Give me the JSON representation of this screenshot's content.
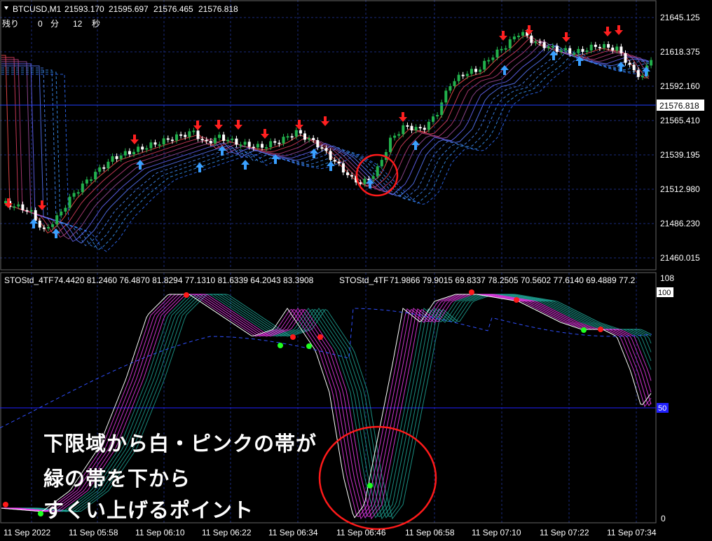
{
  "main_chart": {
    "symbol_header": "BTCUSD,M1",
    "ohlc": [
      "21593.170",
      "21595.697",
      "21576.465",
      "21576.818"
    ],
    "remaining_label": "残り",
    "remaining_min": "0",
    "min_unit": "分",
    "remaining_sec": "12",
    "sec_unit": "秒",
    "price_axis": [
      "21645.125",
      "21618.375",
      "21592.160",
      "21565.410",
      "21539.195",
      "21512.980",
      "21486.230",
      "21460.015"
    ],
    "current_price_tag": "21576.818"
  },
  "sub_chart": {
    "indicator_1": "STOStd_4TF",
    "values_1": "74.4420 81.2460 76.4870 81.8294 77.1310 81.6339 64.2043 83.3908",
    "indicator_2": "STOStd_4TF",
    "values_2": "71.9866 79.9015 69.8337 78.2505 70.5602 77.6140 69.4889 77.2",
    "axis_top": "108",
    "axis_100": "100",
    "axis_50": "50",
    "axis_0": "0"
  },
  "time_axis": [
    "11 Sep 2022",
    "11 Sep 05:58",
    "11 Sep 06:10",
    "11 Sep 06:22",
    "11 Sep 06:34",
    "11 Sep 06:46",
    "11 Sep 06:58",
    "11 Sep 07:10",
    "11 Sep 07:22",
    "11 Sep 07:34"
  ],
  "annotations": [
    "下限域から白・ピンクの帯が",
    "緑の帯を下から",
    "すくい上げるポイント"
  ],
  "colors": {
    "background": "#000000",
    "grid": "#1a2a7a",
    "bull_candle": "#22b14c",
    "bear_candle": "#ffffff",
    "up_arrow": "#3aa0ff",
    "down_arrow": "#ff2020",
    "highlight_circle": "#ff1a1a",
    "stoch_white": "#ffffff",
    "stoch_pink": "#ff40ff",
    "stoch_teal": "#20b0a0",
    "midline": "#2020ff"
  }
}
